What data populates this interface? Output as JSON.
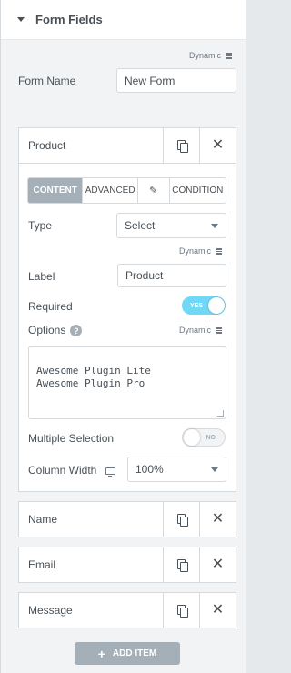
{
  "section": {
    "title": "Form Fields"
  },
  "dynamic_label": "Dynamic",
  "form_name": {
    "label": "Form Name",
    "value": "New Form"
  },
  "fields": [
    {
      "title": "Product"
    },
    {
      "title": "Name"
    },
    {
      "title": "Email"
    },
    {
      "title": "Message"
    }
  ],
  "tabs": {
    "content": "CONTENT",
    "advanced": "ADVANCED",
    "condition": "CONDITION"
  },
  "product": {
    "type_label": "Type",
    "type_value": "Select",
    "label_label": "Label",
    "label_value": "Product",
    "required_label": "Required",
    "required_toggle": "YES",
    "options_label": "Options",
    "options_text": "Awesome Plugin Lite\nAwesome Plugin Pro",
    "multiple_label": "Multiple Selection",
    "multiple_toggle": "NO",
    "width_label": "Column Width",
    "width_value": "100%"
  },
  "add_item": {
    "label": "ADD ITEM"
  },
  "colors": {
    "panel_bg": "#f1f3f5",
    "active_tab": "#a4afb7",
    "toggle_on": "#71d7f7",
    "add_button": "#a4afb7"
  }
}
